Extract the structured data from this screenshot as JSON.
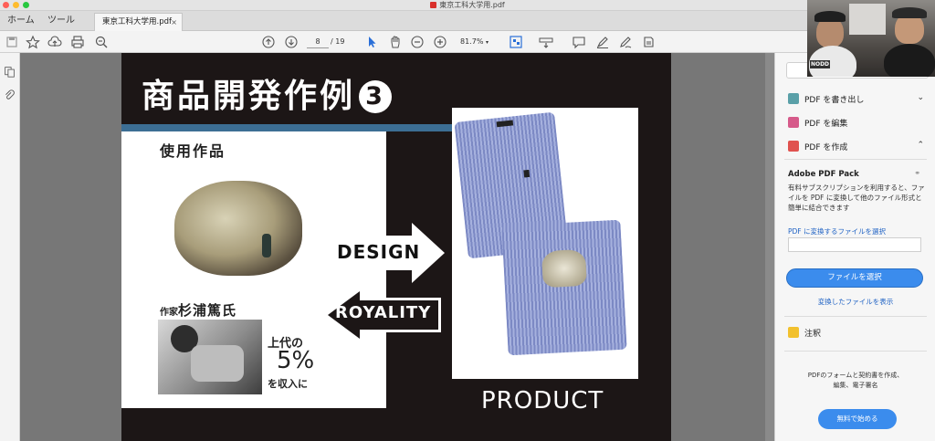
{
  "window": {
    "title": "東京工科大学用.pdf"
  },
  "tabs": {
    "home": "ホーム",
    "tools": "ツール",
    "document": "東京工科大学用.pdf",
    "close": "×"
  },
  "toolbar": {
    "page_current": "8",
    "page_total": "/ 19",
    "zoom": "81.7%"
  },
  "slide": {
    "title": "商品開発作例",
    "title_number": "3",
    "subtitle": "使用作品",
    "artist_prefix": "作家",
    "artist_name": "杉浦篤氏",
    "royalty_line1": "上代の",
    "royalty_percent": "5%",
    "royalty_line3": "を収入に",
    "arrow_design": "DESIGN",
    "arrow_royality": "ROYALITY",
    "product": "PRODUCT"
  },
  "right_panel": {
    "export_pdf": "PDF を書き出し",
    "edit_pdf": "PDF を編集",
    "create_pdf": "PDF を作成",
    "pack_title": "Adobe PDF Pack",
    "pack_desc": "有料サブスクリプションを利用すると、ファイルを PDF に変換して他のファイル形式と簡単に結合できます",
    "select_file_link": "PDF に変換するファイルを選択",
    "select_file_button": "ファイルを選択",
    "show_converted": "変換したファイルを表示",
    "comment": "注釈",
    "footer_line1": "PDFのフォームと契約書を作成、",
    "footer_line2": "編集、電子署名",
    "start_free": "無料で始める"
  },
  "webcam": {
    "label": "NODD"
  },
  "colors": {
    "accent": "#3b8ced",
    "slide_bg": "#1c1616",
    "bar_blue": "#3c6e94",
    "link": "#1f62c4"
  }
}
